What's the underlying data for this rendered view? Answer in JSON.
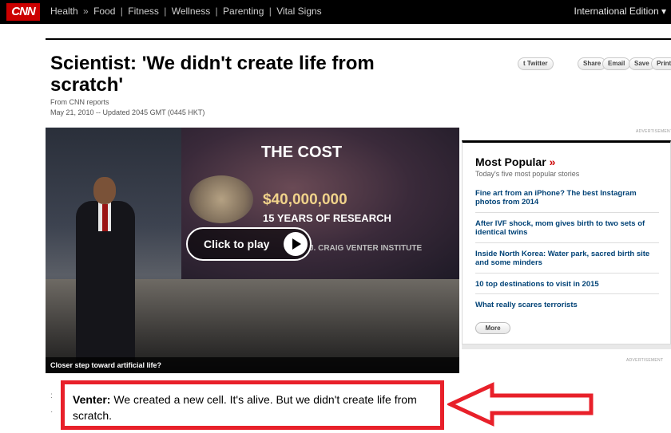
{
  "nav": {
    "logo": "CNN",
    "items": [
      "Health",
      "Food",
      "Fitness",
      "Wellness",
      "Parenting",
      "Vital Signs"
    ],
    "edition": "International Edition"
  },
  "article": {
    "headline": "Scientist: 'We didn't create life from scratch'",
    "byline": "From CNN reports",
    "date": "May 21, 2010 -- Updated 2045 GMT (0445 HKT)"
  },
  "share": [
    "Twitter",
    "Share",
    "Email",
    "Save",
    "Print"
  ],
  "video": {
    "title": "THE COST",
    "amount": "$40,000,000",
    "years": "15 YEARS OF RESEARCH",
    "institute": "J. CRAIG VENTER INSTITUTE",
    "play_label": "Click to play",
    "caption": "Closer step toward artificial life?"
  },
  "ad_label": "ADVERTISEMENT",
  "popular": {
    "title": "Most Popular",
    "arrow": "»",
    "subtitle": "Today's five most popular stories",
    "items": [
      "Fine art from an iPhone? The best Instagram photos from 2014",
      "After IVF shock, mom gives birth to two sets of identical twins",
      "Inside North Korea: Water park, sacred birth site and some minders",
      "10 top destinations to visit in 2015",
      "What really scares terrorists"
    ],
    "more_label": "More"
  },
  "quote": {
    "speaker": "Venter:",
    "text": " We created a new cell. It's alive. But we didn't create life from scratch."
  },
  "colors": {
    "accent_red": "#cc0000",
    "link_blue": "#004276",
    "annotation_red": "#e8202a"
  }
}
